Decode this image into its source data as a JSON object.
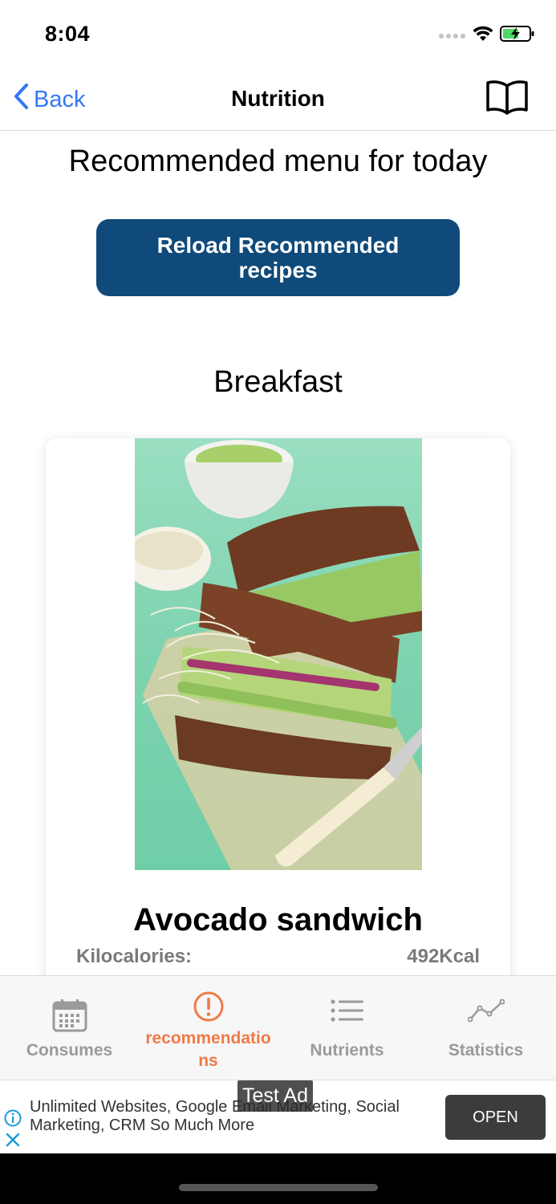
{
  "status": {
    "time": "8:04"
  },
  "nav": {
    "back_label": "Back",
    "title": "Nutrition"
  },
  "main": {
    "heading": "Recommended menu for today",
    "reload_button": "Reload Recommended recipes",
    "meal": "Breakfast",
    "recipe": {
      "name": "Avocado sandwich",
      "kcal_label": "Kilocalories:",
      "kcal_value": "492Kcal"
    }
  },
  "tabs": [
    {
      "label": "Consumes",
      "icon": "calendar-icon",
      "active": false
    },
    {
      "label": "recommendations",
      "icon": "exclamation-circle-icon",
      "active": true
    },
    {
      "label": "Nutrients",
      "icon": "list-icon",
      "active": false
    },
    {
      "label": "Statistics",
      "icon": "line-chart-icon",
      "active": false
    }
  ],
  "ad": {
    "badge": "Test Ad",
    "text": "Unlimited Websites, Google Email Marketing, Social Marketing, CRM So Much More",
    "open_label": "OPEN"
  },
  "colors": {
    "accent": "#3478f6",
    "button": "#0f4a7a",
    "active_tab": "#ef7a47",
    "inactive_tab": "#9a9a9a"
  }
}
